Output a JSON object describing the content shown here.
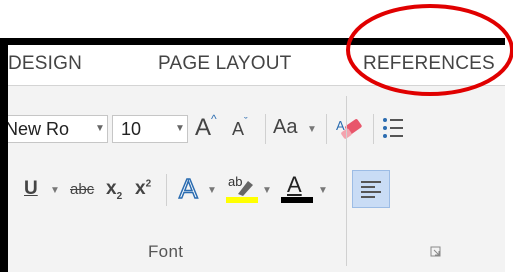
{
  "tabs": [
    {
      "label": "DESIGN"
    },
    {
      "label": "PAGE LAYOUT"
    },
    {
      "label": "REFERENCES"
    }
  ],
  "font": {
    "name_value": "New Ro",
    "size_value": "10",
    "change_case_label": "Aa",
    "bold_like_underline": "U",
    "strike_label": "abc",
    "subscript_label": "x",
    "subscript_mark": "2",
    "superscript_label": "x",
    "superscript_mark": "2",
    "text_effects_label": "A",
    "highlight_label": "ab",
    "font_color_label": "A",
    "group_label": "Font"
  },
  "colors": {
    "highlight_color": "#ffff00",
    "font_color": "#000000",
    "annotation_circle": "#e00000",
    "selected_button": "#c9dcf5"
  }
}
